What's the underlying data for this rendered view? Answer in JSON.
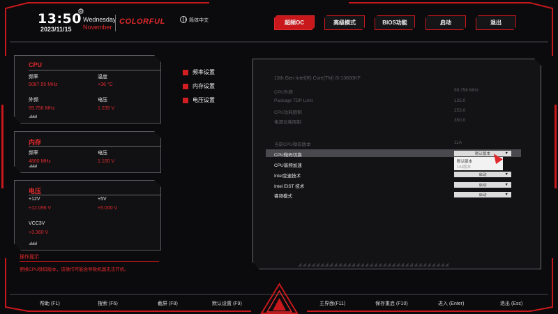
{
  "header": {
    "time": "13:50",
    "date": "2023/11/15",
    "weekday": "Wednesday",
    "month": "November",
    "brand": "COLORFUL",
    "language": "简体中文",
    "tabs": [
      {
        "label": "超频OC",
        "active": true
      },
      {
        "label": "高级模式",
        "active": false
      },
      {
        "label": "BIOS功能",
        "active": false
      },
      {
        "label": "启动",
        "active": false
      },
      {
        "label": "退出",
        "active": false
      }
    ]
  },
  "panels": {
    "cpu": {
      "title": "CPU",
      "freq_label": "频率",
      "freq_value": "5087.55 MHz",
      "temp_label": "温度",
      "temp_value": "+36 °C",
      "bclk_label": "外频",
      "bclk_value": "99.756 MHz",
      "volt_label": "电压",
      "volt_value": "1.235 V"
    },
    "memory": {
      "title": "内存",
      "freq_label": "频率",
      "freq_value": "4800 MHz",
      "volt_label": "电压",
      "volt_value": "1.100 V"
    },
    "voltage": {
      "title": "电压",
      "v12_label": "+12V",
      "v12_value": "+12.096 V",
      "v5_label": "+5V",
      "v5_value": "+5.000 V",
      "vcc_label": "VCC3V",
      "vcc_value": "+3.360 V"
    }
  },
  "hint": {
    "title": "操作提示",
    "text": "更换CPU微码版本，该操作可能会导致机器无法开机。"
  },
  "menu": [
    {
      "label": "频率设置"
    },
    {
      "label": "内存设置"
    },
    {
      "label": "电压设置"
    }
  ],
  "details": {
    "cpu_name": "13th Gen Intel(R) Core(TM) i5-13600KF",
    "info": [
      {
        "label": "CPU外频",
        "value": "99.756 MHz"
      },
      {
        "label": "Package TDP Limit",
        "value": "125.0"
      },
      {
        "label": "CPU功耗限制",
        "value": "253.0"
      },
      {
        "label": "电源功耗限制",
        "value": "350.0"
      }
    ],
    "microcode_label": "当前CPU微码版本",
    "microcode_value": "11A",
    "settings": [
      {
        "label": "CPU微码切换",
        "value": "默认版本"
      },
      {
        "label": "CPU基频加速",
        "value": ""
      },
      {
        "label": "Intel变速技术",
        "value": "启动"
      },
      {
        "label": "Intel EIST 技术",
        "value": "启动"
      },
      {
        "label": "睿频模式",
        "value": "启动"
      }
    ],
    "popup_options": [
      "默认版本",
      "104版本"
    ],
    "dropdown_arrow": "▼"
  },
  "footer": [
    {
      "label": "帮助 (F1)"
    },
    {
      "label": "搜索 (F6)"
    },
    {
      "label": "截屏 (F8)"
    },
    {
      "label": "默认设置 (F9)"
    },
    {
      "label": "主界面(F11)"
    },
    {
      "label": "保存重启 (F10)"
    },
    {
      "label": "进入 (Enter)"
    },
    {
      "label": "退出 (Esc)"
    }
  ],
  "colors": {
    "accent": "#e0292c",
    "tab_active": "#c8181c",
    "background": "#0b0b0d",
    "panel_border": "#5a5a5e"
  }
}
